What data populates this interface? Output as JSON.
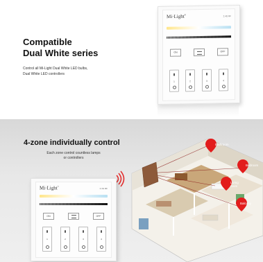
{
  "top": {
    "headline_line1": "Compatible",
    "headline_line2": "Dual White series",
    "desc_line1": "Control all Mi-Light Dual White LED bulbs,",
    "desc_line2": "Dual White LED controllers"
  },
  "panel": {
    "brand": "Mi·Light",
    "brand_sup": "®",
    "sub": "2.4G RF",
    "on": "ON",
    "off": "OFF",
    "zones": [
      "1",
      "2",
      "3",
      "4"
    ]
  },
  "bottom": {
    "title": "4-zone individually control",
    "desc_line1": "Each zone control countless lamps",
    "desc_line2": "or controllers"
  },
  "rooms": {
    "r1": "Bathroom",
    "r2": "Bedroom",
    "r3": "Living room",
    "r4": "Balcony"
  },
  "colors": {
    "pin": "#e21c1c",
    "signal": "#e23030",
    "beam": "#8a1a1a"
  }
}
